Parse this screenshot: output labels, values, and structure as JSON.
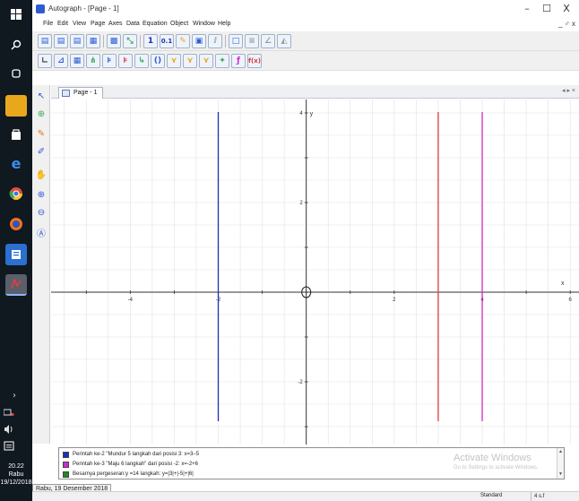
{
  "window": {
    "title": "Autograph - [Page - 1]",
    "controls": {
      "minimize": "–",
      "maximize": "☐",
      "close": "X"
    },
    "doc_controls": "_ ♂ x"
  },
  "menu": [
    "File",
    "Edit",
    "View",
    "Page",
    "Axes",
    "Data",
    "Equation",
    "Object",
    "Window",
    "Help"
  ],
  "toolbar1": {
    "decimal_one": "1",
    "decimal_point_one": "0.1"
  },
  "tab": {
    "label": "Page - 1",
    "nav": "◂ ▸ ×"
  },
  "graph": {
    "x_axis_label": "x",
    "y_axis_label": "y",
    "x_range": [
      -5.8,
      6.2
    ],
    "y_range": [
      -3.4,
      4.3
    ],
    "x_tick_labels": [
      {
        "value": -4,
        "label": "-4"
      },
      {
        "value": -2,
        "label": "-2"
      },
      {
        "value": 2,
        "label": "2"
      },
      {
        "value": 4,
        "label": "4"
      },
      {
        "value": 6,
        "label": "6"
      }
    ],
    "y_tick_labels": [
      {
        "value": 4,
        "label": "4"
      },
      {
        "value": 2,
        "label": "2"
      },
      {
        "value": -2,
        "label": "-2"
      }
    ],
    "vertical_lines": [
      {
        "x": -2,
        "color": "#1f2fb8"
      },
      {
        "x": 3,
        "color": "#e03a3a"
      },
      {
        "x": 4,
        "color": "#cc2ccc"
      }
    ],
    "origin_marker": {
      "x": 0,
      "y": 0
    },
    "axis_color": "#333333",
    "grid_color": "#e1e1e1"
  },
  "key": [
    {
      "color": "#1f2fb8",
      "text": "Perintah ke-2 \"Mundur 5 langkah  dari posisi 3: x=3–5"
    },
    {
      "color": "#cc2ccc",
      "text": "Perintah ke-3 \"Maju 6 langkah\" dari posisi -2: x=-2+6"
    },
    {
      "color": "#1e8a1e",
      "text": "Besarnya pergeseran:y =14 langkah: y=|3|+|-5|+|6|"
    }
  ],
  "watermark": {
    "title": "Activate Windows",
    "subtitle": "Go to Settings to activate Windows."
  },
  "status": {
    "mode": "Standard",
    "sig_figs": "4 s.f"
  },
  "taskbar": {
    "clock_time": "20.22",
    "clock_day": "Rabu",
    "clock_date": "19/12/2018",
    "date_tooltip": "Rabu, 19 Desember 2018",
    "chevron": "›"
  }
}
